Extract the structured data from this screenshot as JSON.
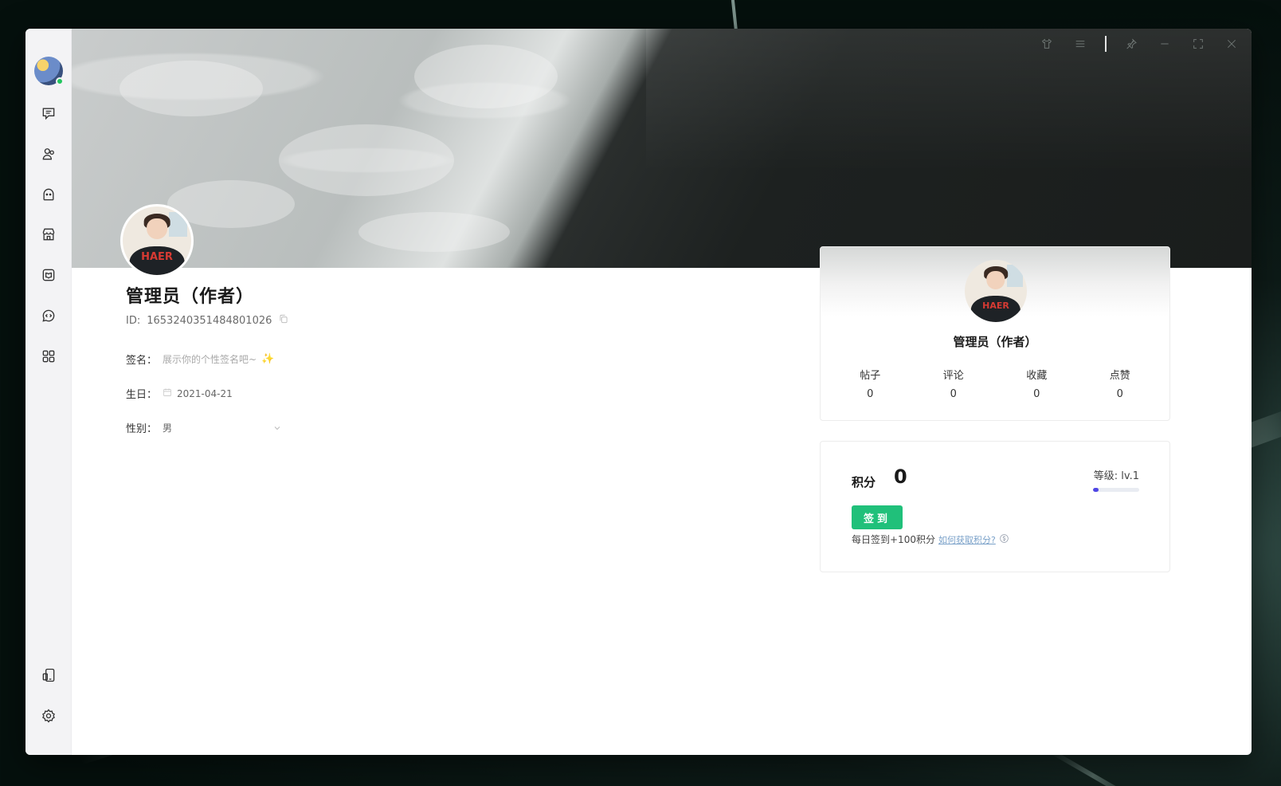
{
  "window_controls": [
    "shirt-icon",
    "menu-icon",
    "pin-icon",
    "minimize-icon",
    "maximize-icon",
    "close-icon"
  ],
  "sidebar": {
    "items": [
      {
        "icon": "message-icon"
      },
      {
        "icon": "users-icon"
      },
      {
        "icon": "ghost-icon"
      },
      {
        "icon": "store-icon"
      },
      {
        "icon": "book-icon"
      },
      {
        "icon": "code-chat-icon"
      },
      {
        "icon": "apps-icon"
      }
    ],
    "bottom": [
      {
        "icon": "device-icon"
      },
      {
        "icon": "settings-icon"
      }
    ]
  },
  "profile": {
    "name": "管理员（作者）",
    "id_label": "ID:",
    "id_value": "1653240351484801026",
    "signature_label": "签名：",
    "signature_placeholder": "展示你的个性签名吧~",
    "signature_emoji": "✨",
    "birthday_label": "生日：",
    "birthday_value": "2021-04-21",
    "gender_label": "性别：",
    "gender_value": "男"
  },
  "avatar_text": "HAER",
  "card": {
    "name": "管理员（作者）",
    "stats": [
      {
        "label": "帖子",
        "value": "0"
      },
      {
        "label": "评论",
        "value": "0"
      },
      {
        "label": "收藏",
        "value": "0"
      },
      {
        "label": "点赞",
        "value": "0"
      }
    ]
  },
  "points": {
    "label": "积分",
    "value": "0",
    "level_label": "等级: lv.1",
    "level_progress": 0.12,
    "sign_button": "签到",
    "hint": "每日签到+100积分",
    "hint_link": "如何获取积分?"
  },
  "colors": {
    "accent_green": "#20c07a",
    "level_bar": "#4f46e5",
    "online": "#22c55e"
  }
}
